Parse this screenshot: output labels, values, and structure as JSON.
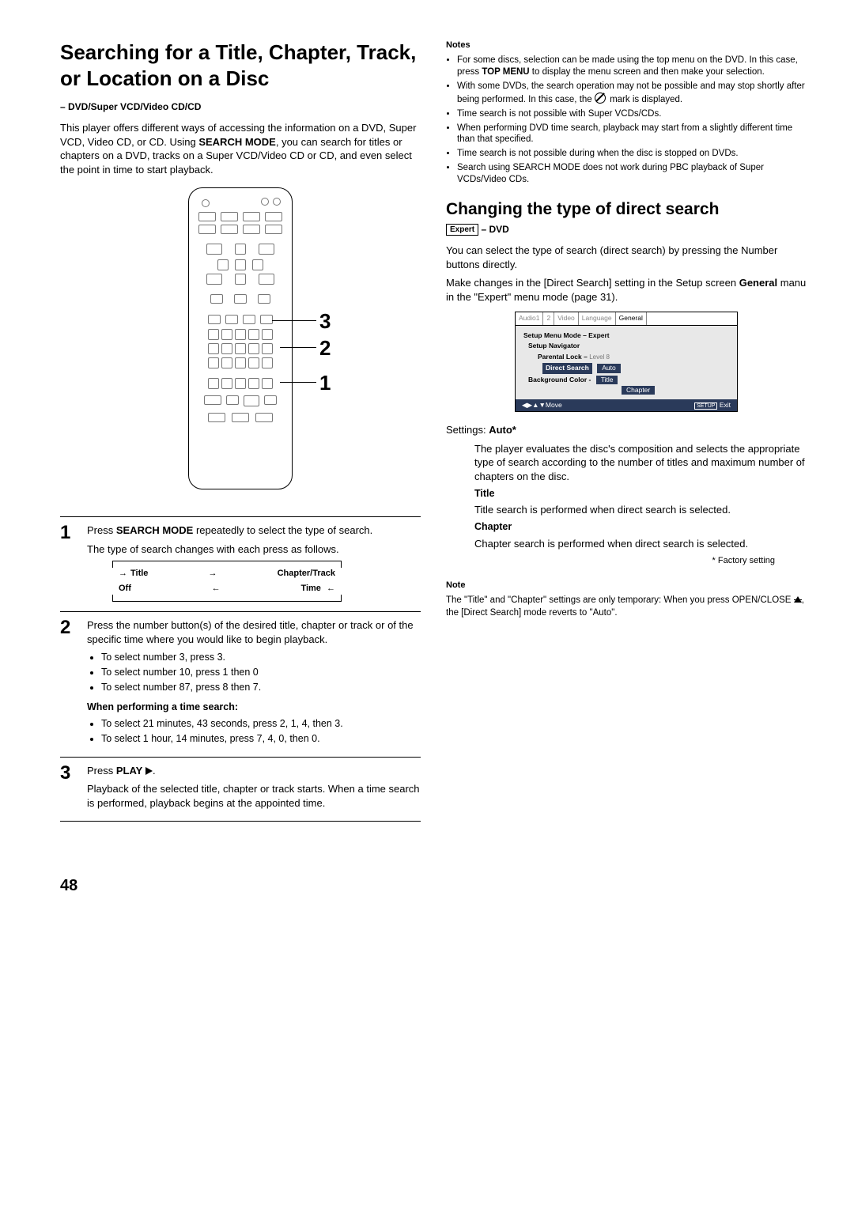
{
  "page_number": "48",
  "left": {
    "title": "Searching for a Title, Chapter, Track, or Location on a Disc",
    "disc_types": "– DVD/Super VCD/Video CD/CD",
    "intro_a": "This player offers different ways of accessing the information on a DVD, Super VCD, Video CD, or CD. Using ",
    "intro_bold": "SEARCH MODE",
    "intro_b": ", you can search for titles or chapters on a DVD, tracks on a Super VCD/Video CD or CD, and even select the point in time to start playback.",
    "remote_labels": {
      "n1": "1",
      "n2": "2",
      "n3": "3"
    },
    "cycle": {
      "title": "Title",
      "chapter": "Chapter/Track",
      "off": "Off",
      "time": "Time"
    },
    "step1": {
      "lead_a": "Press ",
      "lead_bold": "SEARCH MODE",
      "lead_b": " repeatedly to select the type of search.",
      "sub": "The type of search changes with each press as follows."
    },
    "step2": {
      "lead": "Press the number button(s) of the desired title, chapter or track or of the specific time where you would like to begin playback.",
      "items": [
        "To select number 3, press 3.",
        "To select number 10, press 1 then 0",
        "To select number 87, press 8 then 7."
      ],
      "time_head": "When performing a time search:",
      "time_items": [
        "To select  21 minutes, 43 seconds, press 2, 1, 4, then 3.",
        "To select 1 hour, 14 minutes, press 7, 4, 0, then 0."
      ]
    },
    "step3": {
      "lead_a": "Press ",
      "lead_bold": "PLAY",
      "lead_b": ".",
      "sub": "Playback of the selected title, chapter or track starts. When a time search is performed, playback begins at the appointed time."
    }
  },
  "right": {
    "notes_head": "Notes",
    "notes": [
      "For some discs, selection can be made using the top menu on the DVD. In this case, press <b>TOP MENU</b> to display the menu screen and then make your selection.",
      "With some DVDs, the search operation may not be possible and may stop shortly after being performed. In this case, the <icon> mark is displayed.",
      "Time search is not possible with Super VCDs/CDs.",
      "When performing DVD time search, playback may start from a slightly different time than that specified.",
      "Time search is not possible during when the disc is stopped on DVDs.",
      "Search using SEARCH MODE does not work during PBC playback of Super VCDs/Video CDs."
    ],
    "h2": "Changing the type of direct search",
    "expert": "Expert",
    "dvd": " – DVD",
    "p1": "You can select the type of search (direct search) by pressing the Number buttons directly.",
    "p2_a": "Make changes in the [Direct Search] setting in the Setup screen ",
    "p2_bold": "General",
    "p2_b": " manu in the \"Expert\" menu mode (page 31).",
    "setup": {
      "tabs": [
        "Audio1",
        "2",
        "Video",
        "Language",
        "General"
      ],
      "lines": {
        "menu_mode": "Setup Menu Mode – Expert",
        "nav": "Setup Navigator",
        "lock_a": "Parental Lock – ",
        "lock_b": "Level 8",
        "direct": "Direct Search",
        "bg": "Background Color - ",
        "pop_auto": "Auto",
        "pop_title": "Title",
        "pop_chapter": "Chapter"
      },
      "foot_move": "Move",
      "foot_setup": "SETUP",
      "foot_exit": "Exit"
    },
    "settings_label_a": "Settings: ",
    "settings_label_b": "Auto*",
    "auto_desc": "The player evaluates the disc's composition and selects the appropriate type of search according to the number of titles and maximum number of chapters on the disc.",
    "title_head": "Title",
    "title_desc": "Title search is performed when direct search is selected.",
    "chapter_head": "Chapter",
    "chapter_desc": "Chapter search is performed when direct search is selected.",
    "factory": "* Factory setting",
    "note_head": "Note",
    "note_body_a": "The \"Title\" and \"Chapter\" settings are only temporary: When you press OPEN/CLOSE ",
    "note_body_b": ", the [Direct Search] mode reverts to \"Auto\"."
  }
}
